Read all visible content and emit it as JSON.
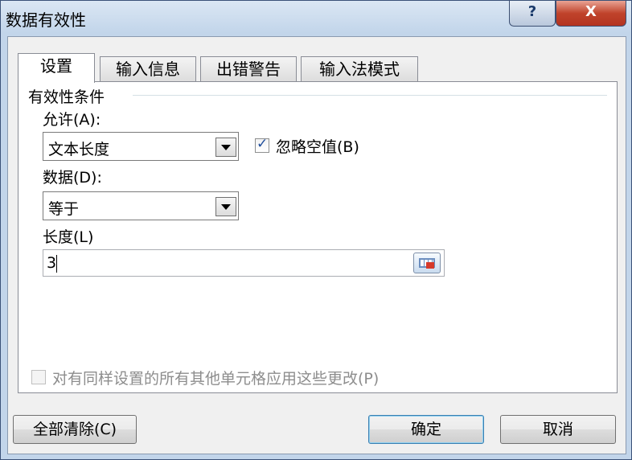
{
  "window": {
    "title": "数据有效性",
    "help_glyph": "?",
    "close_glyph": "X"
  },
  "tabs": [
    {
      "label": "设置",
      "active": true
    },
    {
      "label": "输入信息",
      "active": false
    },
    {
      "label": "出错警告",
      "active": false
    },
    {
      "label": "输入法模式",
      "active": false
    }
  ],
  "settings": {
    "group_title": "有效性条件",
    "allow_label": "允许(A):",
    "allow_value": "文本长度",
    "ignore_blank_label": "忽略空值(B)",
    "ignore_blank_checked": true,
    "data_label": "数据(D):",
    "data_value": "等于",
    "length_label": "长度(L)",
    "length_value": "3",
    "apply_all_label": "对有同样设置的所有其他单元格应用这些更改(P)",
    "apply_all_checked": false,
    "apply_all_enabled": false
  },
  "buttons": {
    "clear_all": "全部清除(C)",
    "ok": "确定",
    "cancel": "取消"
  }
}
